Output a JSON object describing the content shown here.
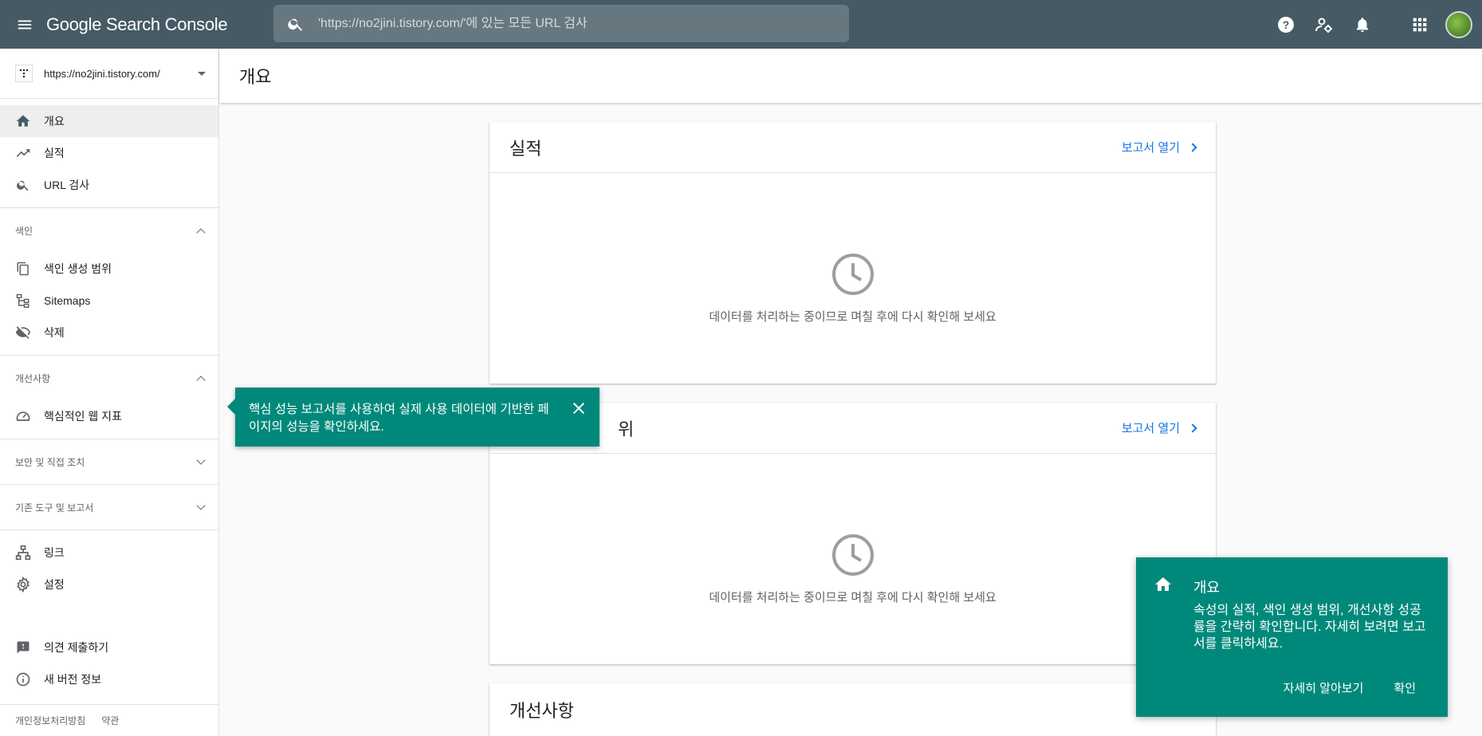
{
  "app": {
    "brand": "Google Search Console"
  },
  "search": {
    "placeholder": "'https://no2jini.tistory.com/'에 있는 모든 URL 검사"
  },
  "sidebar": {
    "property_url": "https://no2jini.tistory.com/",
    "items_top": [
      {
        "label": "개요",
        "icon": "home-icon",
        "active": true
      },
      {
        "label": "실적",
        "icon": "trending-up-icon"
      },
      {
        "label": "URL 검사",
        "icon": "search-icon"
      }
    ],
    "section_index": {
      "label": "색인",
      "items": [
        {
          "label": "색인 생성 범위",
          "icon": "copy-icon"
        },
        {
          "label": "Sitemaps",
          "icon": "sitemap-icon"
        },
        {
          "label": "삭제",
          "icon": "eye-off-icon"
        }
      ]
    },
    "section_enhancements": {
      "label": "개선사항",
      "items": [
        {
          "label": "핵심적인 웹 지표",
          "icon": "speed-gauge-icon"
        }
      ]
    },
    "section_security": {
      "label": "보안 및 직접 조치"
    },
    "section_legacy": {
      "label": "기존 도구 및 보고서"
    },
    "items_misc": [
      {
        "label": "링크",
        "icon": "links-icon"
      },
      {
        "label": "설정",
        "icon": "gear-icon"
      }
    ],
    "items_bottom": [
      {
        "label": "의견 제출하기",
        "icon": "feedback-icon"
      },
      {
        "label": "새 버전 정보",
        "icon": "info-icon"
      }
    ],
    "footer": {
      "privacy": "개인정보처리방침",
      "terms": "약관"
    }
  },
  "page": {
    "title": "개요"
  },
  "cards": [
    {
      "title": "실적",
      "link": "보고서 열기",
      "message": "데이터를 처리하는 중이므로 며칠 후에 다시 확인해 보세요"
    },
    {
      "title": "위",
      "link": "보고서 열기",
      "message": "데이터를 처리하는 중이므로 며칠 후에 다시 확인해 보세요"
    },
    {
      "title": "개선사항"
    }
  ],
  "tooltip": {
    "text": "핵심 성능 보고서를 사용하여 실제 사용 데이터에 기반한 페이지의 성능을 확인하세요."
  },
  "panel": {
    "title": "개요",
    "text": "속성의 실적, 색인 생성 범위, 개선사항 성공률을 간략히 확인합니다. 자세히 보려면 보고서를 클릭하세요.",
    "learn_more": "자세히 알아보기",
    "confirm": "확인"
  },
  "colors": {
    "topbar": "#455a64",
    "accent_teal": "#00897b",
    "link_blue": "#1a73e8"
  }
}
